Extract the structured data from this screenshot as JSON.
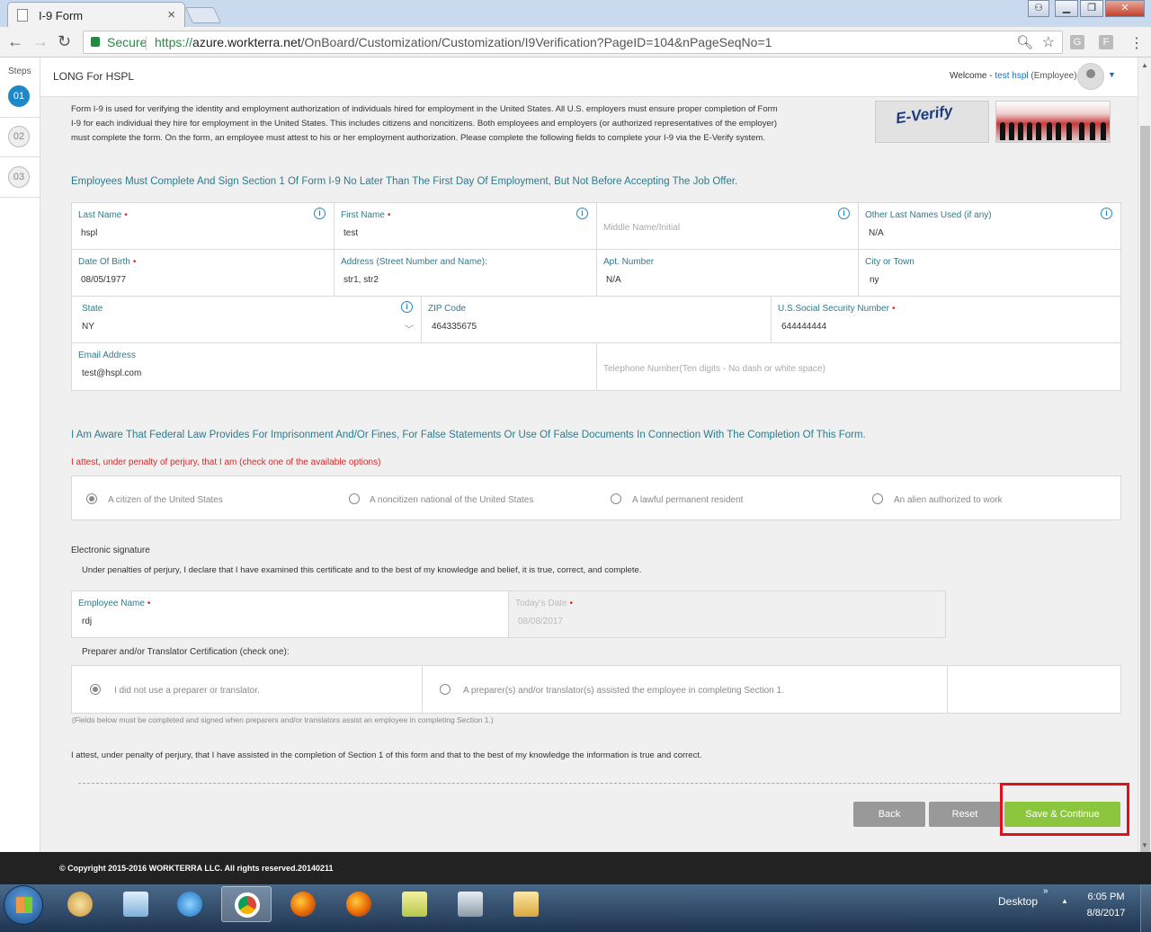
{
  "browser": {
    "tab_title": "I-9 Form",
    "tab_close": "×",
    "secure_label": "Secure",
    "url_scheme": "https://",
    "url_host": "azure.workterra.net",
    "url_path": "/OnBoard/Customization/Customization/I9Verification?PageID=104&nPageSeqNo=1"
  },
  "steps": {
    "label": "Steps",
    "items": [
      "01",
      "02",
      "03"
    ]
  },
  "header": {
    "company": "LONG For HSPL",
    "welcome": "Welcome - ",
    "user_name": "test hspl",
    "user_role": "(Employee)"
  },
  "intro": {
    "text": "Form I-9 is used for verifying the identity and employment authorization of individuals hired for employment in the United States. All U.S. employers must ensure proper completion of Form I-9 for each individual they hire for employment in the United States. This includes citizens and noncitizens. Both employees and employers (or authorized representatives of the employer) must complete the form. On the form, an employee must attest to his or her employment authorization. Please complete the following fields to complete your I-9 via the E-Verify system.",
    "everify_logo": "E-Verify"
  },
  "section1_heading": "Employees Must Complete And Sign Section 1 Of Form I-9 No Later Than The First Day Of Employment, But Not Before Accepting The Job Offer.",
  "fields": {
    "last_name": {
      "label": "Last Name",
      "value": "hspl"
    },
    "first_name": {
      "label": "First Name",
      "value": "test"
    },
    "middle_name": {
      "placeholder": "Middle Name/Initial"
    },
    "other_last_names": {
      "label": "Other Last Names Used (if any)",
      "value": "N/A"
    },
    "dob": {
      "label": "Date Of Birth",
      "value": "08/05/1977"
    },
    "address": {
      "label": "Address (Street Number and Name):",
      "value": "str1, str2"
    },
    "apt": {
      "label": "Apt. Number",
      "value": "N/A"
    },
    "city": {
      "label": "City or Town",
      "value": "ny"
    },
    "state": {
      "label": "State",
      "value": "NY"
    },
    "zip": {
      "label": "ZIP Code",
      "value": "464335675"
    },
    "ssn": {
      "label": "U.S.Social Security Number",
      "value": "644444444"
    },
    "email": {
      "label": "Email Address",
      "value": "test@hspl.com"
    },
    "phone": {
      "placeholder": "Telephone Number(Ten digits - No dash or white space)"
    }
  },
  "awareness_heading": "I Am Aware That Federal Law Provides For Imprisonment And/Or Fines, For False Statements Or Use Of False Documents In Connection With The Completion Of This Form.",
  "attest_heading": "I attest, under penalty of perjury, that I am (check one of the available options)",
  "status_options": [
    {
      "label": "A citizen of the United States",
      "selected": true
    },
    {
      "label": "A noncitizen national of the United States",
      "selected": false
    },
    {
      "label": "A lawful permanent resident",
      "selected": false
    },
    {
      "label": "An alien authorized to work",
      "selected": false
    }
  ],
  "signature": {
    "title": "Electronic signature",
    "note": "Under penalties of perjury, I declare that I have examined this certificate and to the best of my knowledge and belief, it is true, correct, and complete.",
    "employee_name_label": "Employee Name",
    "employee_name_value": "rdj",
    "today_label": "Today's Date",
    "today_value": "08/08/2017"
  },
  "preparer": {
    "title": "Preparer and/or Translator Certification (check one):",
    "options": [
      {
        "label": "I did not use a preparer or translator.",
        "selected": true
      },
      {
        "label": "A preparer(s) and/or translator(s) assisted the employee in completing Section 1.",
        "selected": false
      }
    ],
    "footnote": "(Fields below must be completed and signed when preparers and/or translators assist an employee in completing Section 1.)",
    "attest": "I attest, under penalty of perjury, that I have assisted in the completion of Section 1 of this form and that to the best of my knowledge the information is true and correct."
  },
  "buttons": {
    "back": "Back",
    "reset": "Reset",
    "save": "Save & Continue"
  },
  "footer": "© Copyright 2015-2016 WORKTERRA LLC. All rights reserved.20140211",
  "taskbar": {
    "desktop_label": "Desktop",
    "time": "6:05 PM",
    "date": "8/8/2017"
  },
  "colors": {
    "accent_teal": "#2a7c8e",
    "required_red": "#d12b2b",
    "save_green": "#8cc63f",
    "highlight_red": "#e3101b"
  }
}
